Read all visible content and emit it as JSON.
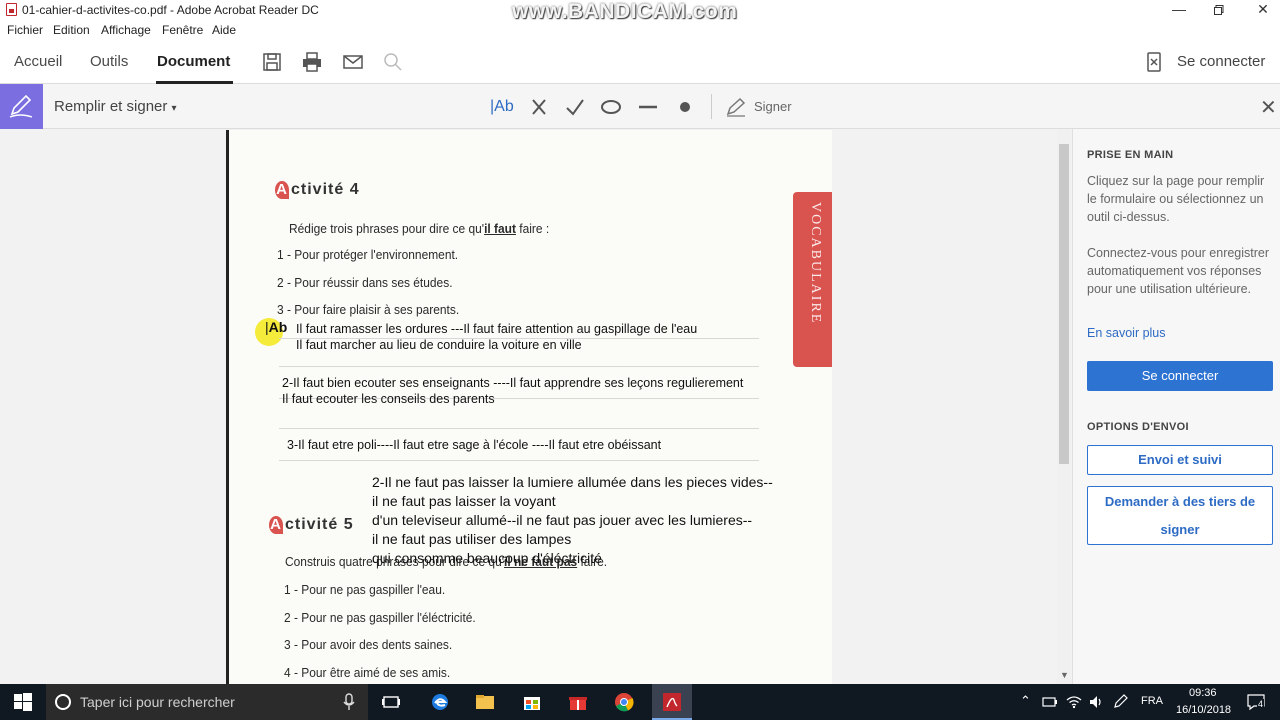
{
  "window": {
    "title": "01-cahier-d-activites-co.pdf - Adobe Acrobat Reader DC",
    "watermark": "www.BANDICAM.com"
  },
  "menu": [
    "Fichier",
    "Edition",
    "Affichage",
    "Fenêtre",
    "Aide"
  ],
  "tabs": {
    "home": "Accueil",
    "tools": "Outils",
    "document": "Document"
  },
  "account": {
    "signin_label": "Se connecter"
  },
  "fill_sign": {
    "label": "Remplir et signer",
    "text_tool": "Ab",
    "sign_label": "Signer"
  },
  "document": {
    "vertical_tab": "VOCABULAIRE",
    "activity4": {
      "letter": "A",
      "title": "ctivité 4",
      "instruction_pre": "Rédige trois phrases pour dire ce qu'",
      "instruction_em": "il faut",
      "instruction_post": " faire :",
      "items": [
        {
          "num": "1",
          "text": "- Pour protéger l'environnement."
        },
        {
          "num": "2",
          "text": "- Pour réussir dans ses études."
        },
        {
          "num": "3",
          "text": "- Pour faire plaisir à ses parents."
        }
      ],
      "field_marker": "Ab",
      "answers": [
        "Il faut ramasser les ordures ---Il faut faire attention au gaspillage de l'eau",
        "Il faut marcher au lieu de conduire la voiture en ville",
        "2-Il faut bien ecouter ses enseignants ----Il faut apprendre ses leçons regulierement",
        "Il faut ecouter les conseils des parents",
        "3-Il faut etre poli----Il faut etre sage à l'école ----Il faut etre obéissant"
      ]
    },
    "activity5_answers": [
      "2-Il ne faut pas laisser la lumiere allumée dans les pieces vides--",
      "il ne faut pas laisser la voyant",
      "d'un televiseur allumé--il ne faut pas jouer avec les lumieres--",
      "il ne faut pas utiliser des lampes",
      "qui consomme beaucoup d'éléctricité"
    ],
    "activity5": {
      "letter": "A",
      "title": "ctivité 5",
      "instruction_pre": "Construis quatre phrases pour dire ce qu'",
      "instruction_em": "il ne faut pas",
      "instruction_post": " faire.",
      "items": [
        "1 - Pour ne pas gaspiller l'eau.",
        "2 - Pour ne pas gaspiller l'éléctricité.",
        "3 - Pour avoir des dents saines.",
        "4 - Pour être aimé de ses amis."
      ]
    }
  },
  "right_panel": {
    "getting_started_title": "PRISE EN MAIN",
    "getting_started_text": "Cliquez sur la page pour remplir le formulaire ou sélectionnez un outil ci-dessus.",
    "connect_text": "Connectez-vous pour enregistrer automatiquement vos réponses pour une utilisation ultérieure.",
    "learn_more": "En savoir plus",
    "connect_button": "Se connecter",
    "send_options_title": "OPTIONS D'ENVOI",
    "send_track_button": "Envoi et suivi",
    "request_others_button": "Demander à des tiers de signer"
  },
  "taskbar": {
    "search_placeholder": "Taper ici pour rechercher",
    "language": "FRA",
    "time": "09:36",
    "date": "16/10/2018",
    "notification_count": "4"
  },
  "colors": {
    "fill_sign_accent": "#7a6ee0",
    "primary_button": "#2d73d2",
    "vocab_tab": "#d9534f",
    "taskbar": "#101822"
  }
}
